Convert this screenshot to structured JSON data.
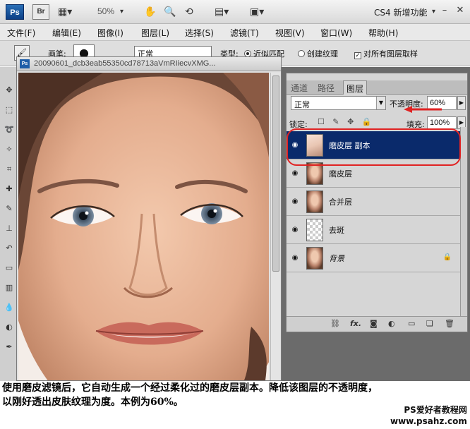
{
  "appbar": {
    "ps_logo": "Ps",
    "br_logo": "Br",
    "zoom": "50%",
    "workspace": "CS4 新增功能",
    "icons": [
      "screen-mode-icon",
      "hand-icon",
      "zoom-icon",
      "rotate-view-icon",
      "arrange-icon",
      "screen-icon",
      "minimize-icon",
      "maximize-icon",
      "close-icon"
    ]
  },
  "menu": [
    "文件(F)",
    "编辑(E)",
    "图像(I)",
    "图层(L)",
    "选择(S)",
    "滤镜(T)",
    "视图(V)",
    "窗口(W)",
    "帮助(H)"
  ],
  "options": {
    "mode_label": "画笔:",
    "mode_value": "正常",
    "type_label": "类型:",
    "radio_1": "近似匹配",
    "radio_2": "创建纹理",
    "check_all": "对所有图层取样"
  },
  "document": {
    "title": "20090601_dcb3eab55350cd78713aVmRIiecvXMG...",
    "ps_badge": "Ps"
  },
  "layers_panel": {
    "tabs": [
      "通道",
      "路径",
      "图层"
    ],
    "active_tab": "图层",
    "blend_mode": "正常",
    "opacity_label": "不透明度:",
    "opacity_value": "60%",
    "lock_label": "锁定:",
    "fill_label": "填充:",
    "fill_value": "100%",
    "layers": [
      {
        "name": "磨皮层 副本",
        "selected": true
      },
      {
        "name": "磨皮层",
        "selected": false
      },
      {
        "name": "合并层",
        "selected": false
      },
      {
        "name": "去斑",
        "selected": false
      },
      {
        "name": "背景",
        "selected": false,
        "locked": true
      }
    ],
    "footer_icons": [
      "link-icon",
      "fx-icon",
      "mask-icon",
      "adjustment-icon",
      "group-icon",
      "new-layer-icon",
      "delete-icon"
    ],
    "footer_labels": {
      "fx": "fx."
    }
  },
  "annotation": {
    "color": "#e02323"
  },
  "caption": {
    "line1": "使用磨皮滤镜后，它自动生成一个经过柔化过的磨皮层副本。降低该图层的不透明度，",
    "line2": "以刚好透出皮肤纹理为度。本例为60%。"
  },
  "watermark": {
    "line1": "PS爱好者教程网",
    "line2": "www.psahz.com"
  }
}
